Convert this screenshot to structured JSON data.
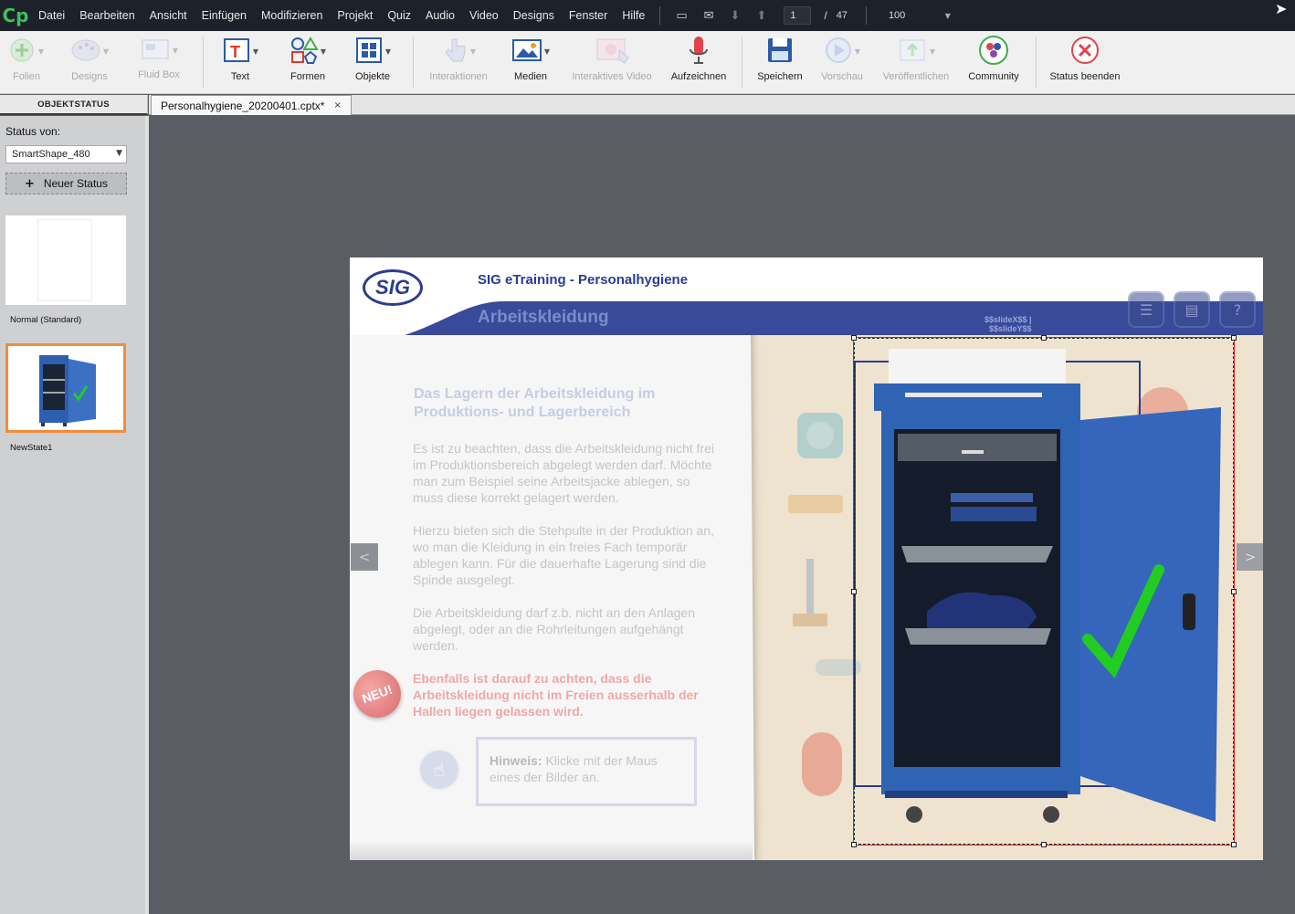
{
  "menubar": {
    "logo": "Cp",
    "items": [
      "Datei",
      "Bearbeiten",
      "Ansicht",
      "Einfügen",
      "Modifizieren",
      "Projekt",
      "Quiz",
      "Audio",
      "Video",
      "Designs",
      "Fenster",
      "Hilfe"
    ],
    "slide_current": "1",
    "slide_separator": "/",
    "slide_total": "47",
    "zoom": "100"
  },
  "toolbar": {
    "folien": "Folien",
    "designs": "Designs",
    "fluid_box": "Fluid Box",
    "text": "Text",
    "formen": "Formen",
    "objekte": "Objekte",
    "interaktionen": "Interaktionen",
    "medien": "Medien",
    "interaktives_video": "Interaktives Video",
    "aufzeichnen": "Aufzeichnen",
    "speichern": "Speichern",
    "vorschau": "Vorschau",
    "veroeffentlichen": "Veröffentlichen",
    "community": "Community",
    "status_beenden": "Status beenden"
  },
  "left_panel": {
    "tab_title": "OBJEKTSTATUS",
    "status_label": "Status von:",
    "status_object": "SmartShape_480",
    "new_state_button": "Neuer Status",
    "states": [
      {
        "label": "Normal (Standard)"
      },
      {
        "label": "NewState1"
      }
    ]
  },
  "document": {
    "tab_title": "Personalhygiene_20200401.cptx*",
    "close_symbol": "×"
  },
  "slide": {
    "logo_text": "SIG",
    "course_title": "SIG eTraining - Personalhygiene",
    "subtitle": "Arbeitskleidung",
    "var_line1": "$$slideX$$ |",
    "var_line2": "$$slideY$$",
    "content_title": "Das Lagern der Arbeitskleidung im Produktions- und Lagerbereich",
    "paragraph1": "Es ist zu beachten, dass die Arbeitskleidung nicht frei im Produktionsbereich abgelegt werden darf. Möchte man zum Beispiel seine Arbeitsjacke ablegen, so muss diese korrekt gelagert werden.",
    "paragraph2": "Hierzu bieten sich die Stehpulte in der Produktion an, wo man die Kleidung in ein freies Fach temporär ablegen kann. Für die dauerhafte Lagerung sind die Spinde ausgelegt.",
    "paragraph3": "Die Arbeitskleidung darf z.b. nicht an den Anlagen abgelegt, oder an die Rohrleitungen aufgehängt werden.",
    "paragraph_red": "Ebenfalls ist darauf zu achten, dass die Arbeitskleidung nicht im Freien ausserhalb der Hallen liegen gelassen wird.",
    "neu_badge": "NEU!",
    "hint_bold": "Hinweis:",
    "hint_text": " Klicke mit der Maus eines der Bilder an.",
    "prev": "<",
    "next": ">"
  },
  "colors": {
    "brand_blue": "#2a3d8f",
    "accent_green": "#22cc22",
    "selection_red": "#e02020",
    "state_highlight": "#f28c3c"
  }
}
